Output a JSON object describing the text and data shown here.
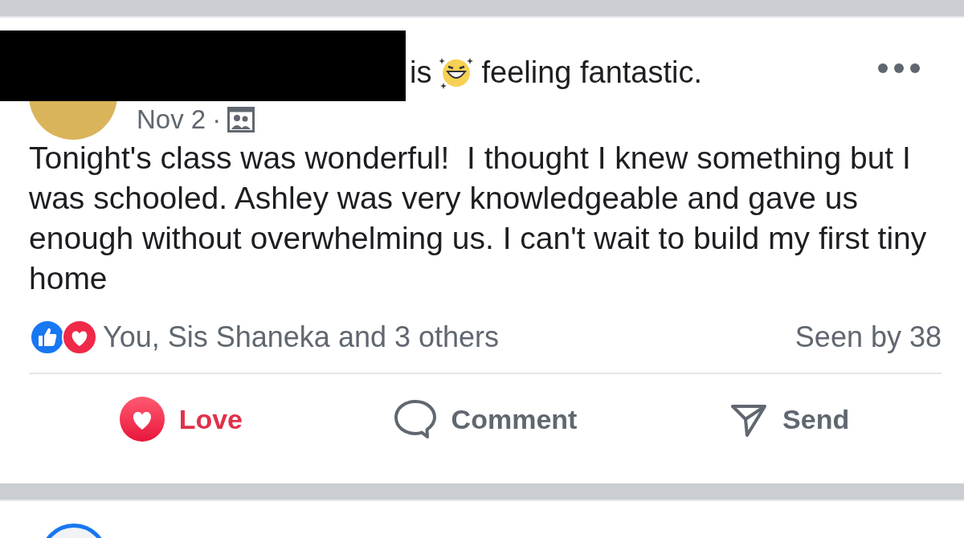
{
  "post": {
    "status_verb": "is",
    "feeling": "feeling fantastic.",
    "date": "Nov 2",
    "date_separator": "·",
    "body": "Tonight's class was wonderful!  I thought I knew something but I was schooled. Ashley was very knowledgeable and gave us enough without overwhelming us. I can't wait to build my first tiny home",
    "reactions_summary": "You, Sis Shaneka and 3 others",
    "seen_by": "Seen by 38",
    "actions": [
      {
        "kind": "love",
        "label": "Love",
        "selected": true
      },
      {
        "kind": "comment",
        "label": "Comment",
        "selected": false
      },
      {
        "kind": "send",
        "label": "Send",
        "selected": false
      }
    ]
  }
}
